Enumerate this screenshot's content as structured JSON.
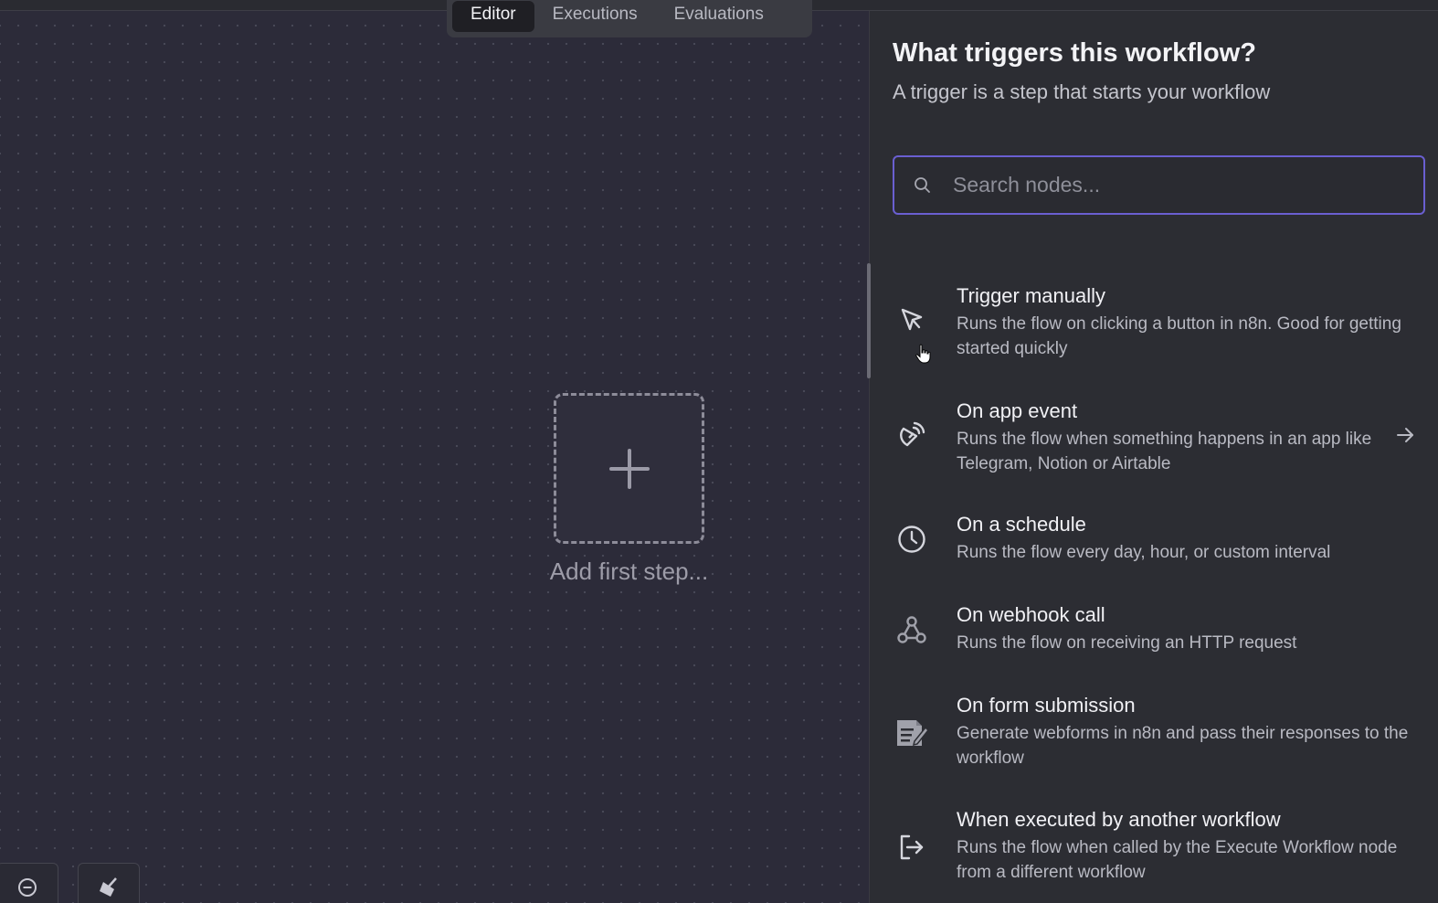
{
  "tabs": [
    {
      "label": "Editor",
      "active": true
    },
    {
      "label": "Executions",
      "active": false
    },
    {
      "label": "Evaluations",
      "active": false
    }
  ],
  "canvas": {
    "add_step_label": "Add first step..."
  },
  "panel": {
    "title": "What triggers this workflow?",
    "subtitle": "A trigger is a step that starts your workflow",
    "search": {
      "placeholder": "Search nodes...",
      "value": ""
    },
    "nodes": [
      {
        "title": "Trigger manually",
        "description": "Runs the flow on clicking a button in n8n. Good for getting started quickly",
        "icon": "cursor-arrow-icon"
      },
      {
        "title": "On app event",
        "description": "Runs the flow when something happens in an app like Telegram, Notion or Airtable",
        "icon": "satellite-dish-icon",
        "has_arrow": true
      },
      {
        "title": "On a schedule",
        "description": "Runs the flow every day, hour, or custom interval",
        "icon": "clock-icon"
      },
      {
        "title": "On webhook call",
        "description": "Runs the flow on receiving an HTTP request",
        "icon": "webhook-icon"
      },
      {
        "title": "On form submission",
        "description": "Generate webforms in n8n and pass their responses to the workflow",
        "icon": "form-icon"
      },
      {
        "title": "When executed by another workflow",
        "description": "Runs the flow when called by the Execute Workflow node from a different workflow",
        "icon": "sign-out-icon"
      }
    ]
  },
  "colors": {
    "accent": "#6a5fd1",
    "canvas_bg": "#2c2b39",
    "panel_bg": "#2c2d33"
  }
}
